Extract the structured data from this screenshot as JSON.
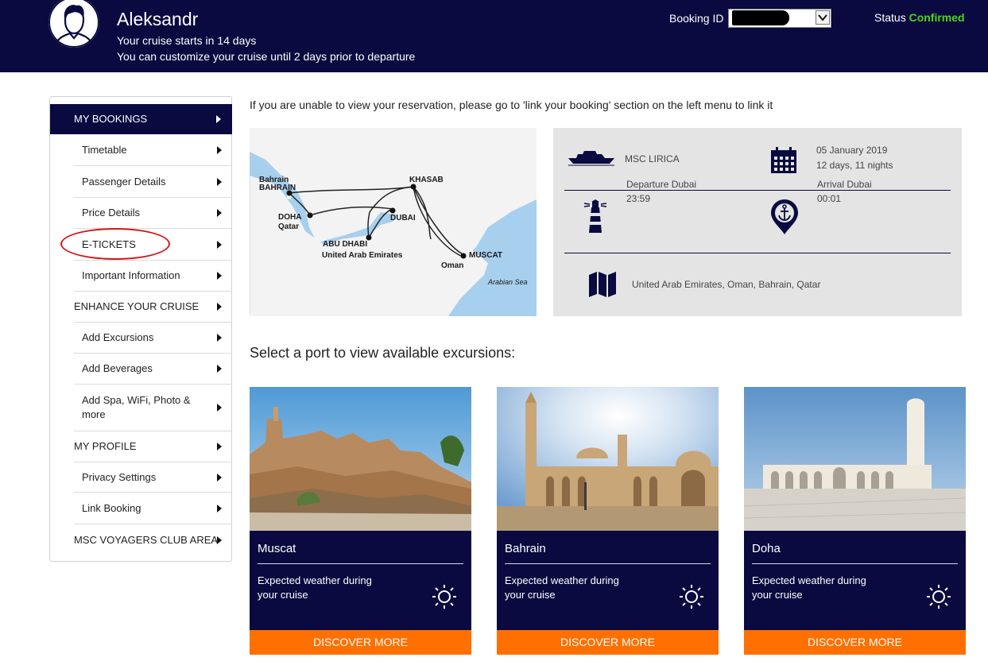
{
  "header": {
    "user_name": "Aleksandr",
    "line1": "Your cruise starts in 14 days",
    "line2": "You can customize your cruise until 2 days prior to departure",
    "booking_label": "Booking ID",
    "status_label": "Status",
    "status_value": "Confirmed",
    "status_color": "#4ed51a"
  },
  "sidebar": {
    "items": [
      {
        "label": "MY BOOKINGS"
      },
      {
        "label": "Timetable"
      },
      {
        "label": "Passenger Details"
      },
      {
        "label": "Price Details"
      },
      {
        "label": "E-TICKETS"
      },
      {
        "label": "Important Information"
      },
      {
        "label": "ENHANCE YOUR CRUISE"
      },
      {
        "label": "Add Excursions"
      },
      {
        "label": "Add Beverages"
      },
      {
        "label": "Add Spa, WiFi, Photo & more"
      },
      {
        "label": "MY PROFILE"
      },
      {
        "label": "Privacy Settings"
      },
      {
        "label": "Link Booking"
      },
      {
        "label": "MSC VOYAGERS CLUB AREA"
      }
    ]
  },
  "main": {
    "notice": "If you are unable to view your reservation, please go to 'link your booking' section on the left menu to link it",
    "map_labels": {
      "bahrain_1": "Bahrain",
      "bahrain_2": "BAHRAIN",
      "doha": "DOHA",
      "qatar": "Qatar",
      "khasab": "KHASAB",
      "dubai": "DUBAI",
      "abu_dhabi": "ABU DHABI",
      "uae": "United Arab Emirates",
      "muscat": "MUSCAT",
      "oman": "Oman",
      "arabian_sea": "Arabian Sea"
    },
    "info": {
      "ship": "MSC LIRICA",
      "date": "05 January 2019",
      "duration": "12 days, 11 nights",
      "departure_label": "Departure Dubai",
      "departure_time": "23:59",
      "arrival_label": "Arrival Dubai",
      "arrival_time": "00:01",
      "countries": "United Arab Emirates, Oman, Bahrain, Qatar"
    },
    "ports_title": "Select a port to view available excursions:",
    "ports": [
      {
        "city": "Muscat",
        "weather": "Expected weather during your cruise",
        "button": "DISCOVER MORE"
      },
      {
        "city": "Bahrain",
        "weather": "Expected weather during your cruise",
        "button": "DISCOVER MORE"
      },
      {
        "city": "Doha",
        "weather": "Expected weather during your cruise",
        "button": "DISCOVER MORE"
      }
    ]
  },
  "colors": {
    "navy": "#0a0a40",
    "orange": "#ff7000",
    "map_sea": "#a7cfee",
    "land": "#f2f2f2",
    "highlight": "#d4161b"
  }
}
